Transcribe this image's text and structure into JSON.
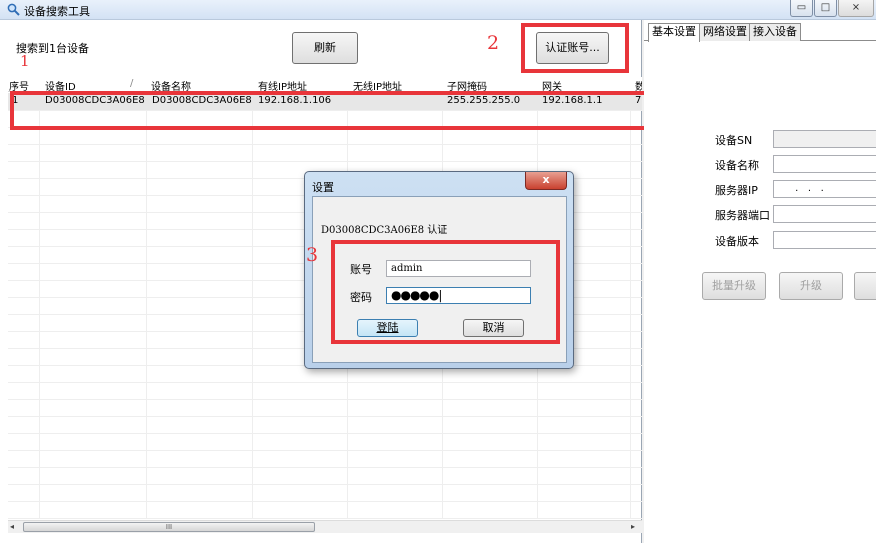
{
  "window": {
    "title": "设备搜索工具",
    "min_glyph": "▭",
    "max_glyph": "□",
    "close_glyph": "⨯"
  },
  "toolbar": {
    "found_label": "搜索到1台设备",
    "refresh_label": "刷新",
    "auth_label": "认证账号..."
  },
  "annotations": {
    "n1": "1",
    "n2": "2",
    "n3": "3",
    "color": "#e8353a"
  },
  "grid": {
    "columns": [
      "序号",
      "设备ID",
      "设备名称",
      "有线IP地址",
      "无线IP地址",
      "子网掩码",
      "网关",
      "数"
    ],
    "sort_glyph": "/",
    "rows": [
      [
        "1",
        "D03008CDC3A06E8",
        "D03008CDC3A06E8",
        "192.168.1.106",
        "",
        "255.255.255.0",
        "192.168.1.1",
        "7"
      ]
    ],
    "scroll_left": "◂",
    "scroll_right": "▸",
    "scroll_grip": "III"
  },
  "right_panel": {
    "tabs": [
      "基本设置",
      "网络设置",
      "接入设备"
    ],
    "fields": [
      {
        "label": "设备SN",
        "value": ""
      },
      {
        "label": "设备名称",
        "value": ""
      },
      {
        "label": "服务器IP",
        "value": " .   .   . "
      },
      {
        "label": "服务器端口",
        "value": ""
      },
      {
        "label": "设备版本",
        "value": ""
      }
    ],
    "batch_upgrade": "批量升级",
    "upgrade": "升级"
  },
  "dialog": {
    "title": "设置",
    "close": "x",
    "heading": "D03008CDC3A06E8 认证",
    "username_label": "账号",
    "username_value": "admin",
    "password_label": "密码",
    "password_mask": "●●●●●|",
    "login": "登陆",
    "cancel": "取消"
  }
}
